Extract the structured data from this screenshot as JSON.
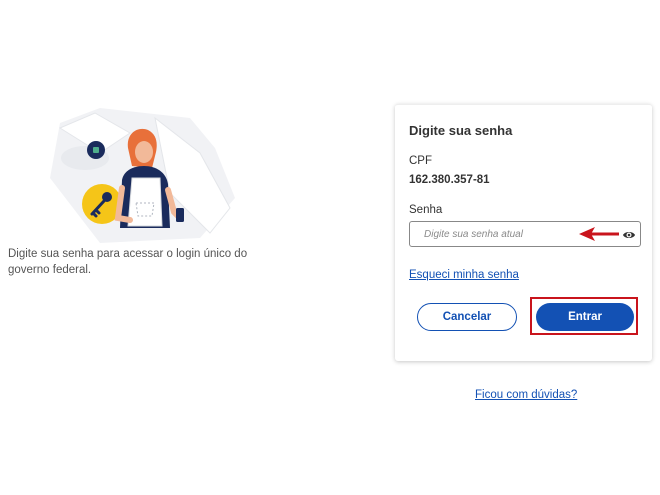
{
  "intro": {
    "message": "Digite sua senha para acessar o login único do governo federal."
  },
  "card": {
    "title": "Digite sua senha",
    "cpf_label": "CPF",
    "cpf_value": "162.380.357-81",
    "password_label": "Senha",
    "password_placeholder": "Digite sua senha atual",
    "password_value": "",
    "show_password_icon": "eye-icon",
    "forgot_link": "Esqueci minha senha",
    "cancel_label": "Cancelar",
    "enter_label": "Entrar"
  },
  "help_link": "Ficou com dúvidas?",
  "colors": {
    "primary": "#1351b4",
    "annotation": "#c9141c",
    "illustration_yellow": "#f5c518",
    "illustration_navy": "#1a2b5c"
  }
}
